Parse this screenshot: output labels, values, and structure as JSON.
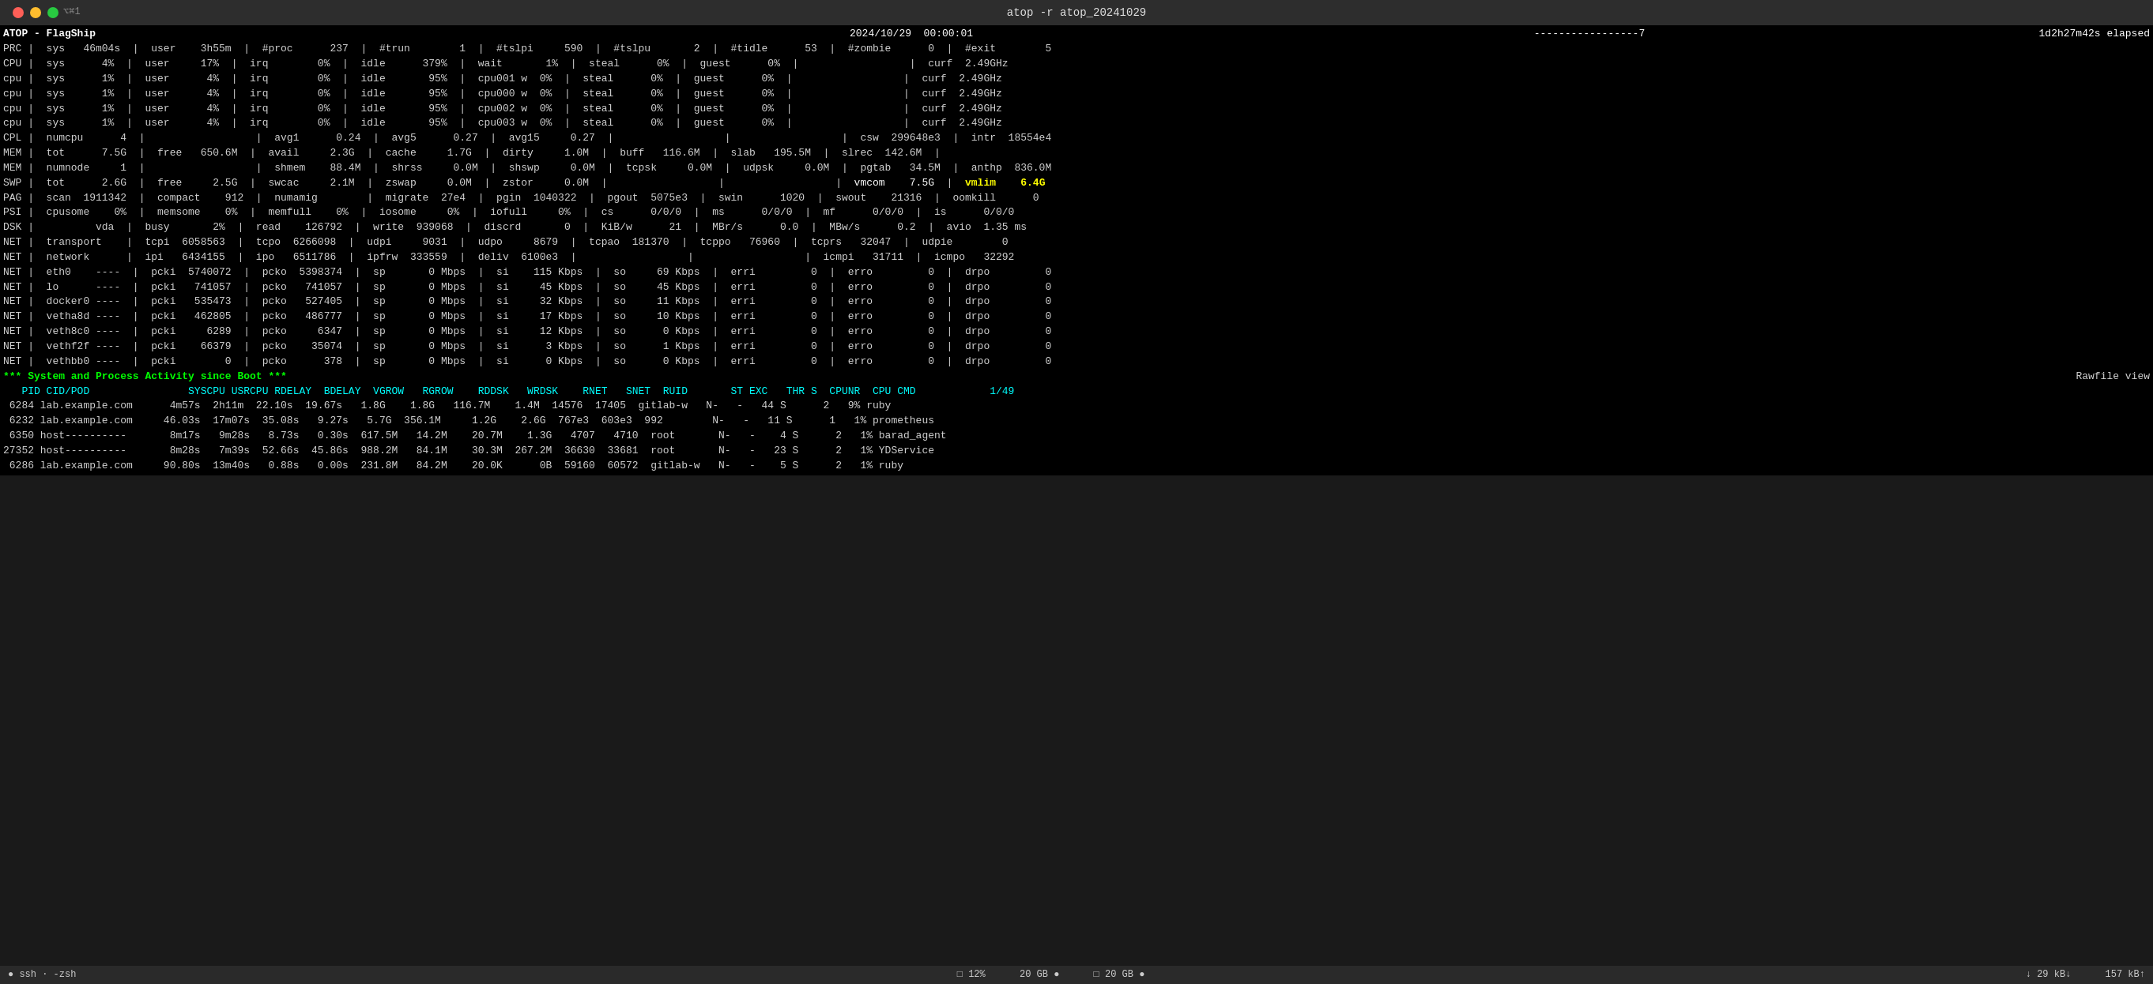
{
  "titlebar": {
    "title": "atop -r atop_20241029",
    "shortcut": "⌥⌘1",
    "traffic_lights": [
      "red",
      "yellow",
      "green"
    ]
  },
  "header": {
    "atop_label": "ATOP - FlagShip",
    "datetime": "2024/10/29  00:00:01",
    "separator": "-----------------7",
    "elapsed": "1d2h27m42s elapsed"
  },
  "rows": {
    "prc": "PRC |  sys   46m04s  |  user    3h55m  |  #proc      237  |  #trun        1  |  #tslpi     590  |  #tslpu       2  |  #tidle      53  |  #zombie      0  |  #exit        5",
    "cpu1": "CPU |  sys      4%  |  user     17%  |  irq        0%  |  idle      379%  |  wait       1%  |  steal      0%  |  guest      0%  |                  |  curf  2.49GHz",
    "cpu2": "cpu |  sys      1%  |  user      4%  |  irq        0%  |  idle       95%  |  cpu001 w  0%  |  steal      0%  |  guest      0%  |                  |  curf  2.49GHz",
    "cpu3": "cpu |  sys      1%  |  user      4%  |  irq        0%  |  idle       95%  |  cpu000 w  0%  |  steal      0%  |  guest      0%  |                  |  curf  2.49GHz",
    "cpu4": "cpu |  sys      1%  |  user      4%  |  irq        0%  |  idle       95%  |  cpu002 w  0%  |  steal      0%  |  guest      0%  |                  |  curf  2.49GHz",
    "cpu5": "cpu |  sys      1%  |  user      4%  |  irq        0%  |  idle       95%  |  cpu003 w  0%  |  steal      0%  |  guest      0%  |                  |  curf  2.49GHz",
    "cpl": "CPL |  numcpu      4  |                  |  avg1      0.24  |  avg5      0.27  |  avg15     0.27  |                  |                  |  csw  299648e3  |  intr  18554e4",
    "mem1": "MEM |  tot      7.5G  |  free   650.6M  |  avail     2.3G  |  cache     1.7G  |  dirty     1.0M  |  buff   116.6M  |  slab   195.5M  |  slrec  142.6M  |",
    "mem2": "MEM |  numnode     1  |                  |  shmem    88.4M  |  shrss     0.0M  |  shswp     0.0M  |  tcpsk     0.0M  |  udpsk     0.0M  |  pgtab   34.5M  |  anthp  836.0M",
    "swp": "SWP |  tot      2.6G  |  free     2.5G  |  swcac     2.1M  |  zswap     0.0M  |  zstor     0.0M  |                  |                  |  vmcom    7.5G  |  vmlim    6.4G",
    "pag": "PAG |  scan  1911342  |  compact    912  |  numamig        |  migrate  27e4  |  pgin  1040322  |  pgout  5075e3  |  swin      1020  |  swout    21316  |  oomkill      0",
    "psi": "PSI |  cpusome    0%  |  memsome    0%  |  memfull    0%  |  iosome     0%  |  iofull     0%  |  cs      0/0/0  |  ms      0/0/0  |  mf      0/0/0  |  is      0/0/0",
    "dsk": "DSK |          vda  |  busy       2%  |  read    126792  |  write  939068  |  discrd       0  |  KiB/w      21  |  MBr/s      0.0  |  MBw/s      0.2  |  avio  1.35 ms",
    "net_transport": "NET |  transport    |  tcpi  6058563  |  tcpo  6266098  |  udpi     9031  |  udpo     8679  |  tcpao  181370  |  tcppo   76960  |  tcprs   32047  |  udpie        0",
    "net_network": "NET |  network      |  ipi   6434155  |  ipo   6511786  |  ipfrw  333559  |  deliv  6100e3  |                  |                  |  icmpi   31711  |  icmpo   32292",
    "net_eth0": "NET |  eth0    ----  |  pcki  5740072  |  pcko  5398374  |  sp       0 Mbps  |  si    115 Kbps  |  so     69 Kbps  |  erri         0  |  erro         0  |  drpo         0",
    "net_lo": "NET |  lo      ----  |  pcki   741057  |  pcko   741057  |  sp       0 Mbps  |  si     45 Kbps  |  so     45 Kbps  |  erri         0  |  erro         0  |  drpo         0",
    "net_docker0": "NET |  docker0 ----  |  pcki   535473  |  pcko   527405  |  sp       0 Mbps  |  si     32 Kbps  |  so     11 Kbps  |  erri         0  |  erro         0  |  drpo         0",
    "net_vetha8d": "NET |  vetha8d ----  |  pcki   462805  |  pcko   486777  |  sp       0 Mbps  |  si     17 Kbps  |  so     10 Kbps  |  erri         0  |  erro         0  |  drpo         0",
    "net_veth8c0": "NET |  veth8c0 ----  |  pcki     6289  |  pcko     6347  |  sp       0 Mbps  |  si     12 Kbps  |  so      0 Kbps  |  erri         0  |  erro         0  |  drpo         0",
    "net_vethf2f": "NET |  vethf2f ----  |  pcki    66379  |  pcko    35074  |  sp       0 Mbps  |  si      3 Kbps  |  so      1 Kbps  |  erri         0  |  erro         0  |  drpo         0",
    "net_vethbb0": "NET |  vethbb0 ----  |  pcki        0  |  pcko      378  |  sp       0 Mbps  |  si      0 Kbps  |  so      0 Kbps  |  erri         0  |  erro         0  |  drpo         0"
  },
  "system_banner": "*** System and Process Activity since Boot ***",
  "rawfile_label": "Rawfile view",
  "process_header": "   PID CID/POD                SYSCPU USRCPU RDELAY  BDELAY  VGROW   RGROW    RDDSK   WRDSK    RNET   SNET  RUID       ST EXC   THR S  CPUNR  CPU CMD            1/49",
  "processes": [
    {
      "pid": "6284",
      "cid": "lab.example.com",
      "syscpu": "4m57s",
      "usrcpu": "2h11m",
      "rdelay": "22.10s",
      "bdelay": "19.67s",
      "vgrow": "1.8G",
      "rgrow": "1.8G",
      "rddsk": "116.7M",
      "wrdsk": "1.4M",
      "rnet": "14576",
      "snet": "17405",
      "ruid": "gitlab-w",
      "st": "N-",
      "exc": "-",
      "thr": "44",
      "s": "S",
      "cpunr": "2",
      "cpu": "9%",
      "cmd": "ruby"
    },
    {
      "pid": "6232",
      "cid": "lab.example.com",
      "syscpu": "46.03s",
      "usrcpu": "17m07s",
      "rdelay": "35.08s",
      "bdelay": "9.27s",
      "vgrow": "5.7G",
      "rgrow": "356.1M",
      "rddsk": "1.2G",
      "wrdsk": "2.6G",
      "rnet": "767e3",
      "snet": "603e3",
      "ruid": "992",
      "st": "N-",
      "exc": "-",
      "thr": "11",
      "s": "S",
      "cpunr": "1",
      "cpu": "1%",
      "cmd": "prometheus"
    },
    {
      "pid": "6350",
      "cid": "host----------",
      "syscpu": "8m17s",
      "usrcpu": "9m28s",
      "rdelay": "8.73s",
      "bdelay": "0.30s",
      "vgrow": "617.5M",
      "rgrow": "14.2M",
      "rddsk": "20.7M",
      "wrdsk": "1.3G",
      "rnet": "4707",
      "snet": "4710",
      "ruid": "root",
      "st": "N-",
      "exc": "-",
      "thr": "4",
      "s": "S",
      "cpunr": "2",
      "cpu": "1%",
      "cmd": "barad_agent"
    },
    {
      "pid": "27352",
      "cid": "host----------",
      "syscpu": "8m28s",
      "usrcpu": "7m39s",
      "rdelay": "52.66s",
      "bdelay": "45.86s",
      "vgrow": "988.2M",
      "rgrow": "84.1M",
      "rddsk": "30.3M",
      "wrdsk": "267.2M",
      "rnet": "36630",
      "snet": "33681",
      "ruid": "root",
      "st": "N-",
      "exc": "-",
      "thr": "23",
      "s": "S",
      "cpunr": "2",
      "cpu": "1%",
      "cmd": "YDService"
    },
    {
      "pid": "6286",
      "cid": "lab.example.com",
      "syscpu": "90.80s",
      "usrcpu": "13m40s",
      "rdelay": "0.88s",
      "bdelay": "0.00s",
      "vgrow": "231.8M",
      "rgrow": "84.2M",
      "rddsk": "20.0K",
      "wrdsk": "0B",
      "rnet": "59160",
      "snet": "60572",
      "ruid": "gitlab-w",
      "st": "N-",
      "exc": "-",
      "thr": "5",
      "s": "S",
      "cpunr": "2",
      "cpu": "1%",
      "cmd": "ruby"
    }
  ],
  "statusbar": {
    "left": "● ssh · -zsh",
    "middle_left": "□ 12%",
    "middle": "20 GB ●",
    "middle_right": "□ 20 GB ●",
    "right_net": "↓ 29 kB↓",
    "right_disk": "157 kB↑"
  },
  "colors": {
    "background": "#000000",
    "text": "#d0d0d0",
    "green": "#00ff00",
    "yellow": "#ffff00",
    "cyan": "#00ffff",
    "white": "#ffffff"
  }
}
